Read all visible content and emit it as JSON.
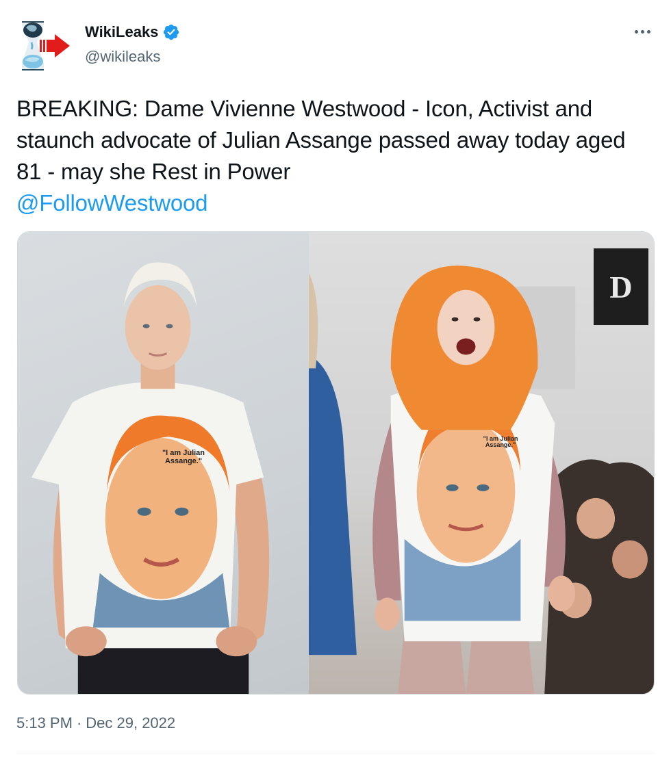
{
  "author": {
    "display_name": "WikiLeaks",
    "handle": "@wikileaks",
    "verified": true,
    "avatar_icon": "wikileaks-hourglass-logo",
    "verified_icon": "verified-badge-icon"
  },
  "tweet": {
    "text": "BREAKING: Dame Vivienne Westwood - Icon, Activist and staunch advocate of Julian Assange passed away today aged 81 - may she Rest in Power",
    "mention": "@FollowWestwood"
  },
  "media": {
    "left_shirt_text": "\"I am Julian Assange.\"",
    "right_shirt_text": "\"I am Julian Assange.\"",
    "runway_sign": "D"
  },
  "footer": {
    "time": "5:13 PM",
    "separator": "·",
    "date": "Dec 29, 2022"
  },
  "colors": {
    "link": "#1d9bf0",
    "secondary_text": "#536471",
    "primary_text": "#0f1419"
  }
}
